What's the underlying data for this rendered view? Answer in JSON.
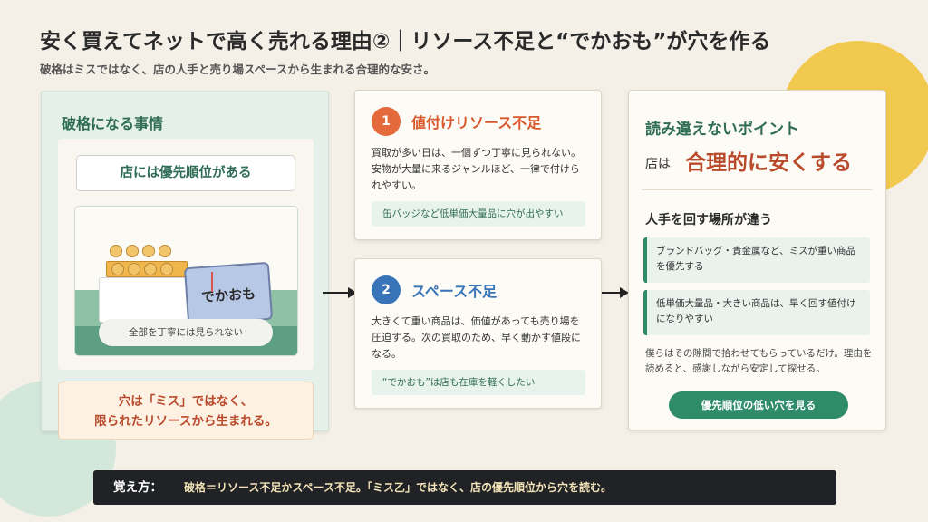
{
  "header": {
    "title": "安く買えてネットで高く売れる理由②｜リソース不足と“でかおも”が穴を作る",
    "subtitle": "破格はミスではなく、店の人手と売り場スペースから生まれる合理的な安さ。"
  },
  "left_panel": {
    "title": "破格になる事情",
    "priority_label": "店には優先順位がある",
    "box_label": "でかおも",
    "pill_label": "全部を丁寧には見られない",
    "note_line1": "穴は「ミス」ではなく、",
    "note_line2": "限られたリソースから生まれる。"
  },
  "card1": {
    "number": "1",
    "heading": "値付けリソース不足",
    "body": "買取が多い日は、一個ずつ丁寧に見られない。安物が大量に来るジャンルほど、一律で付けられやすい。",
    "tip": "缶バッジなど低単価大量品に穴が出やすい"
  },
  "card2": {
    "number": "2",
    "heading": "スペース不足",
    "body": "大きくて重い商品は、価値があっても売り場を圧迫する。次の買取のため、早く動かす値段になる。",
    "tip": "“でかおも”は店も在庫を軽くしたい"
  },
  "right_card": {
    "title": "読み違えないポイント",
    "shop": "店は",
    "emphasis": "合理的に安くする",
    "subheading": "人手を回す場所が違う",
    "items": [
      "ブランドバッグ・貴金属など、ミスが重い商品を優先する",
      "低単価大量品・大きい商品は、早く回す値付けになりやすい"
    ],
    "note": "僕らはその隙間で拾わせてもらっているだけ。理由を読めると、感謝しながら安定して探せる。",
    "button": "優先順位の低い穴を見る"
  },
  "footer": {
    "label": "覚え方：",
    "text": "破格＝リソース不足かスペース不足。「ミス乙」ではなく、店の優先順位から穴を読む。"
  },
  "colors": {
    "accent_green": "#2f8c6b",
    "accent_orange": "#e46a3b",
    "accent_blue": "#3a74b8",
    "emphasis_red": "#b94a2b"
  }
}
